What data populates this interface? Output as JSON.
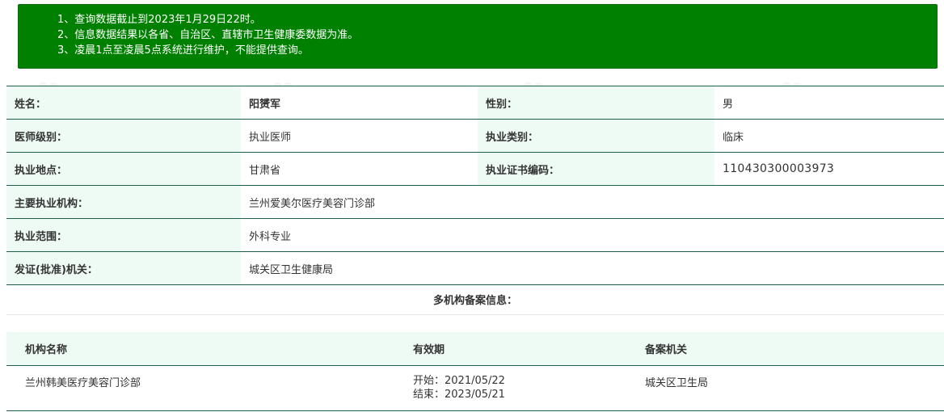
{
  "notice": {
    "lines": [
      "1、查询数据截止到2023年1月29日22时。",
      "2、信息数据结果以各省、自治区、直辖市卫生健康委数据为准。",
      "3、凌晨1点至凌晨5点系统进行维护，不能提供查询。"
    ],
    "bg_color": "#008000"
  },
  "info": {
    "name_label": "姓名：",
    "name_value": "阳赟军",
    "gender_label": "性别：",
    "gender_value": "男",
    "level_label": "医师级别：",
    "level_value": "执业医师",
    "category_label": "执业类别：",
    "category_value": "临床",
    "location_label": "执业地点：",
    "location_value": "甘肃省",
    "cert_label": "执业证书编码：",
    "cert_value": "110430300003973",
    "institution_label": "主要执业机构：",
    "institution_value": "兰州爱美尔医疗美容门诊部",
    "scope_label": "执业范围：",
    "scope_value": "外科专业",
    "authority_label": "发证(批准)机关：",
    "authority_value": "城关区卫生健康局"
  },
  "multi": {
    "title": "多机构备案信息：",
    "headers": {
      "org": "机构名称",
      "validity": "有效期",
      "authority": "备案机关"
    },
    "rows": [
      {
        "org": "兰州韩美医疗美容门诊部",
        "start": "开始：2021/05/22",
        "end": "结束：2023/05/21",
        "authority": "城关区卫生局"
      }
    ]
  }
}
